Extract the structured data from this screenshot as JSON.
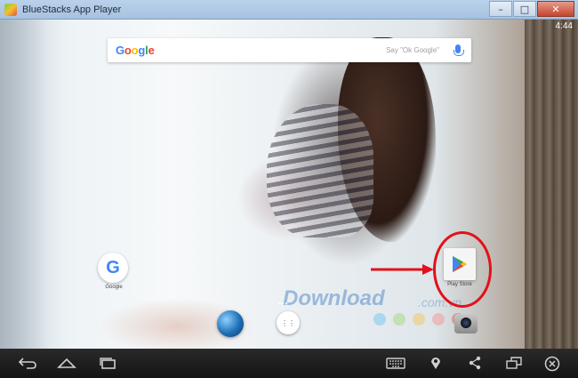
{
  "window": {
    "title": "BlueStacks App Player",
    "minimize_glyph": "–",
    "maximize_glyph": "□",
    "close_glyph": "✕"
  },
  "status_bar": {
    "time": "4:44"
  },
  "search": {
    "logo_letters": [
      "G",
      "o",
      "o",
      "g",
      "l",
      "e"
    ],
    "logo_colors": [
      "#4285f4",
      "#ea4335",
      "#fbbc05",
      "#4285f4",
      "#34a853",
      "#ea4335"
    ],
    "hint": "Say \"Ok Google\""
  },
  "apps": {
    "google": {
      "glyph": "G",
      "label": "Google"
    },
    "play_store": {
      "label": "Play Store"
    }
  },
  "dock": {
    "page_dots": "•••",
    "apps_glyph": "⋮⋮"
  },
  "watermark": {
    "text": "Download",
    "suffix": ".com.vn",
    "dot_colors": [
      "#7ec6f0",
      "#a9d88a",
      "#f0c86a",
      "#f29a9a",
      "#e46060"
    ]
  },
  "annotation": {
    "highlight_color": "#e1111b"
  },
  "navbar": {
    "icons": [
      "back-icon",
      "home-icon",
      "recent-apps-icon",
      "keyboard-icon",
      "location-icon",
      "share-icon",
      "multi-window-icon",
      "close-icon"
    ]
  }
}
